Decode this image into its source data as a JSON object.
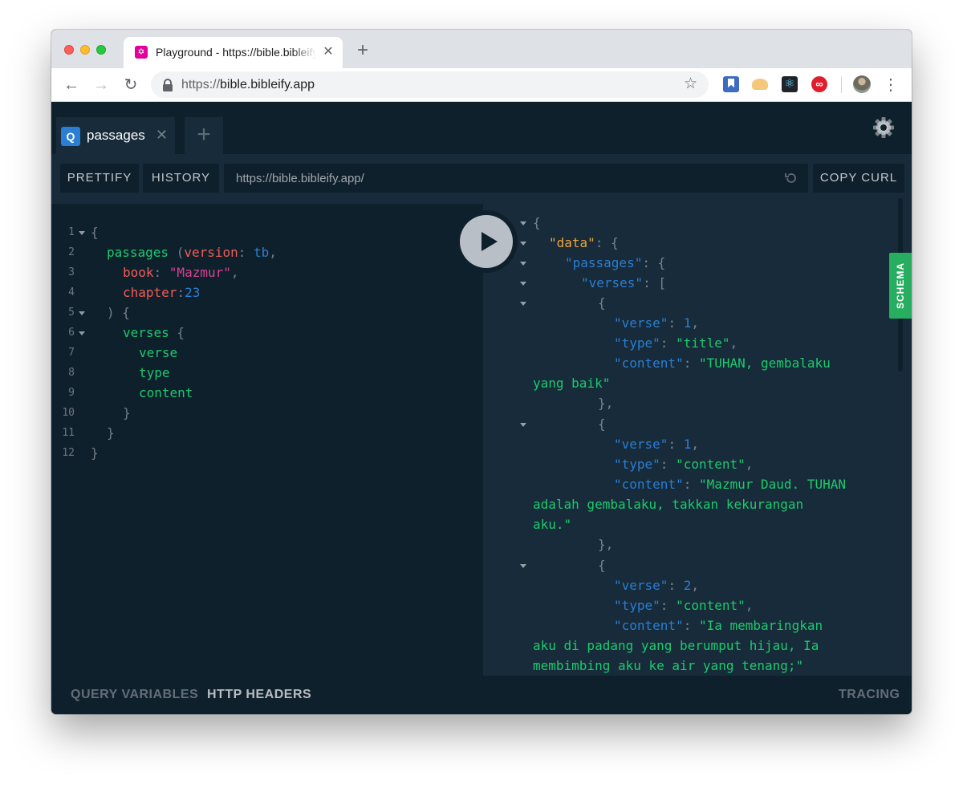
{
  "browser": {
    "tab_title": "Playground - https://bible.bibleify.app/",
    "new_tab": "+",
    "url_scheme": "https://",
    "url_host": "bible.bibleify.app"
  },
  "playground": {
    "tab_badge": "Q",
    "tab_label": "passages",
    "add_tab": "+",
    "buttons": {
      "prettify": "PRETTIFY",
      "history": "HISTORY",
      "copy_curl": "COPY CURL"
    },
    "endpoint": "https://bible.bibleify.app/",
    "schema_tab": "SCHEMA",
    "bottom": {
      "query_variables": "QUERY VARIABLES",
      "http_headers": "HTTP HEADERS",
      "tracing": "TRACING"
    }
  },
  "editor": {
    "line_numbers": [
      "1",
      "2",
      "3",
      "4",
      "5",
      "6",
      "7",
      "8",
      "9",
      "10",
      "11",
      "12"
    ],
    "lines": [
      [
        {
          "t": "{",
          "c": "punc"
        }
      ],
      [
        {
          "t": "passages",
          "c": "field"
        },
        {
          "t": " (",
          "c": "punc"
        },
        {
          "t": "version",
          "c": "arg"
        },
        {
          "t": ": ",
          "c": "punc"
        },
        {
          "t": "tb",
          "c": "var"
        },
        {
          "t": ",",
          "c": "punc"
        }
      ],
      [
        {
          "t": "book",
          "c": "arg"
        },
        {
          "t": ": ",
          "c": "punc"
        },
        {
          "t": "\"Mazmur\"",
          "c": "str"
        },
        {
          "t": ",",
          "c": "punc"
        }
      ],
      [
        {
          "t": "chapter",
          "c": "arg"
        },
        {
          "t": ":",
          "c": "punc"
        },
        {
          "t": "23",
          "c": "num"
        }
      ],
      [
        {
          "t": ") {",
          "c": "punc"
        }
      ],
      [
        {
          "t": "verses",
          "c": "field"
        },
        {
          "t": " {",
          "c": "punc"
        }
      ],
      [
        {
          "t": "verse",
          "c": "field"
        }
      ],
      [
        {
          "t": "type",
          "c": "field"
        }
      ],
      [
        {
          "t": "content",
          "c": "field"
        }
      ],
      [
        {
          "t": "}",
          "c": "punc"
        }
      ],
      [
        {
          "t": "}",
          "c": "punc"
        }
      ],
      [
        {
          "t": "}",
          "c": "punc"
        }
      ]
    ]
  },
  "results": {
    "lines": [
      [
        {
          "t": "{",
          "c": "punc"
        }
      ],
      [
        {
          "t": "\"data\"",
          "c": "rootkey"
        },
        {
          "t": ": {",
          "c": "punc"
        }
      ],
      [
        {
          "t": "\"passages\"",
          "c": "key"
        },
        {
          "t": ": {",
          "c": "punc"
        }
      ],
      [
        {
          "t": "\"verses\"",
          "c": "key"
        },
        {
          "t": ": [",
          "c": "punc"
        }
      ],
      [
        {
          "t": "{",
          "c": "punc"
        }
      ],
      [
        {
          "t": "\"verse\"",
          "c": "key"
        },
        {
          "t": ": ",
          "c": "punc"
        },
        {
          "t": "1",
          "c": "num"
        },
        {
          "t": ",",
          "c": "punc"
        }
      ],
      [
        {
          "t": "\"type\"",
          "c": "key"
        },
        {
          "t": ": ",
          "c": "punc"
        },
        {
          "t": "\"title\"",
          "c": "jstr"
        },
        {
          "t": ",",
          "c": "punc"
        }
      ],
      [
        {
          "t": "\"content\"",
          "c": "key"
        },
        {
          "t": ": ",
          "c": "punc"
        },
        {
          "t": "\"TUHAN, gembalaku",
          "c": "jstr"
        }
      ],
      [
        {
          "t": "yang baik\"",
          "c": "jstr"
        }
      ],
      [
        {
          "t": "},",
          "c": "punc"
        }
      ],
      [
        {
          "t": "{",
          "c": "punc"
        }
      ],
      [
        {
          "t": "\"verse\"",
          "c": "key"
        },
        {
          "t": ": ",
          "c": "punc"
        },
        {
          "t": "1",
          "c": "num"
        },
        {
          "t": ",",
          "c": "punc"
        }
      ],
      [
        {
          "t": "\"type\"",
          "c": "key"
        },
        {
          "t": ": ",
          "c": "punc"
        },
        {
          "t": "\"content\"",
          "c": "jstr"
        },
        {
          "t": ",",
          "c": "punc"
        }
      ],
      [
        {
          "t": "\"content\"",
          "c": "key"
        },
        {
          "t": ": ",
          "c": "punc"
        },
        {
          "t": "\"Mazmur Daud. TUHAN",
          "c": "jstr"
        }
      ],
      [
        {
          "t": "adalah gembalaku, takkan kekurangan",
          "c": "jstr"
        }
      ],
      [
        {
          "t": "aku.\"",
          "c": "jstr"
        }
      ],
      [
        {
          "t": "},",
          "c": "punc"
        }
      ],
      [
        {
          "t": "{",
          "c": "punc"
        }
      ],
      [
        {
          "t": "\"verse\"",
          "c": "key"
        },
        {
          "t": ": ",
          "c": "punc"
        },
        {
          "t": "2",
          "c": "num"
        },
        {
          "t": ",",
          "c": "punc"
        }
      ],
      [
        {
          "t": "\"type\"",
          "c": "key"
        },
        {
          "t": ": ",
          "c": "punc"
        },
        {
          "t": "\"content\"",
          "c": "jstr"
        },
        {
          "t": ",",
          "c": "punc"
        }
      ],
      [
        {
          "t": "\"content\"",
          "c": "key"
        },
        {
          "t": ": ",
          "c": "punc"
        },
        {
          "t": "\"Ia membaringkan",
          "c": "jstr"
        }
      ],
      [
        {
          "t": "aku di padang yang berumput hijau, Ia",
          "c": "jstr"
        }
      ],
      [
        {
          "t": "membimbing aku ke air yang tenang;\"",
          "c": "jstr"
        }
      ]
    ]
  }
}
